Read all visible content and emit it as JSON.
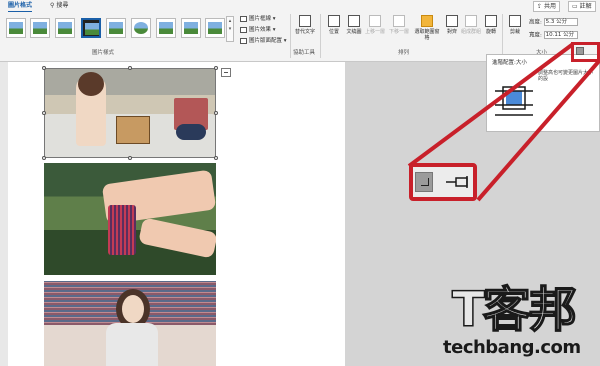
{
  "tabs": {
    "format": "圖片格式",
    "search": "搜尋"
  },
  "header_buttons": {
    "share": "共用",
    "comment": "註解"
  },
  "groups": {
    "picture_styles": "圖片樣式",
    "accessibility": "協助工具",
    "arrange": "排列",
    "size": "大小"
  },
  "style_commands": {
    "border": "圖片框線",
    "effects": "圖片效果",
    "layout": "圖片版面配置"
  },
  "big_buttons": {
    "alt_text": "替代文字",
    "position": "位置",
    "wrap_text": "文繞圖",
    "bring_forward": "上移一層",
    "send_backward": "下移一層",
    "selection_pane": "選取範圍窗格",
    "align": "對齊",
    "group": "組成群組",
    "rotate": "旋轉",
    "crop": "剪裁"
  },
  "size_fields": {
    "height_label": "高度:",
    "height_value": "5.3 公分",
    "width_label": "寬度:",
    "width_value": "10.11 公分"
  },
  "tooltip": {
    "title": "進階配置:大小",
    "description": "調整高也可變更圖片大小的設"
  },
  "watermark": {
    "logo": "T客邦",
    "url": "techbang.com"
  },
  "colors": {
    "callout": "#c8202a",
    "accent": "#1a5fa8"
  }
}
